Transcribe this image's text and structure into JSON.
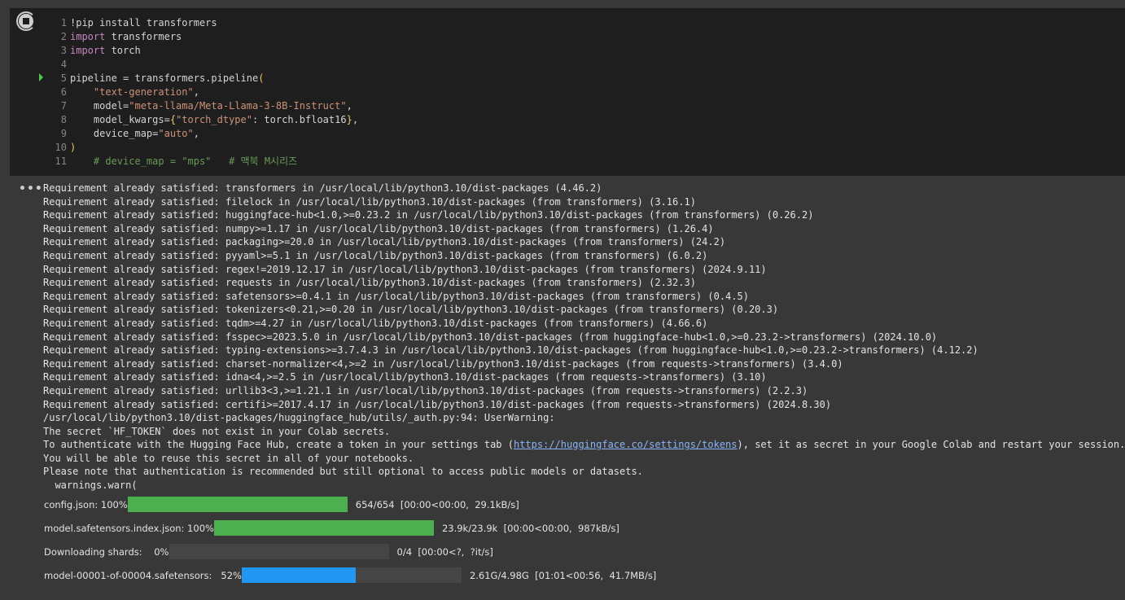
{
  "code_lines": [
    {
      "num": "1",
      "html": "!pip install transformers"
    },
    {
      "num": "2",
      "html": "<span class=\"kw\">import</span> transformers"
    },
    {
      "num": "3",
      "html": "<span class=\"kw\">import</span> torch"
    },
    {
      "num": "4",
      "html": ""
    },
    {
      "num": "5",
      "html": "pipeline = transformers.pipeline<span class=\"br\">(</span>"
    },
    {
      "num": "6",
      "html": "    <span class=\"str\">\"text-generation\"</span>,"
    },
    {
      "num": "7",
      "html": "    model=<span class=\"str\">\"meta-llama/Meta-Llama-3-8B-Instruct\"</span>,"
    },
    {
      "num": "8",
      "html": "    model_kwargs=<span class=\"br\">{</span><span class=\"str\">\"torch_dtype\"</span>: torch.bfloat16<span class=\"br\">}</span>,"
    },
    {
      "num": "9",
      "html": "    device_map=<span class=\"str\">\"auto\"</span>,"
    },
    {
      "num": "10",
      "html": "<span class=\"br\">)</span>"
    },
    {
      "num": "11",
      "html": "    <span class=\"cmt\"># device_map = \"mps\"   # 맥북 M시리즈</span>"
    }
  ],
  "output": {
    "log_lines": [
      "Requirement already satisfied: transformers in /usr/local/lib/python3.10/dist-packages (4.46.2)",
      "Requirement already satisfied: filelock in /usr/local/lib/python3.10/dist-packages (from transformers) (3.16.1)",
      "Requirement already satisfied: huggingface-hub<1.0,>=0.23.2 in /usr/local/lib/python3.10/dist-packages (from transformers) (0.26.2)",
      "Requirement already satisfied: numpy>=1.17 in /usr/local/lib/python3.10/dist-packages (from transformers) (1.26.4)",
      "Requirement already satisfied: packaging>=20.0 in /usr/local/lib/python3.10/dist-packages (from transformers) (24.2)",
      "Requirement already satisfied: pyyaml>=5.1 in /usr/local/lib/python3.10/dist-packages (from transformers) (6.0.2)",
      "Requirement already satisfied: regex!=2019.12.17 in /usr/local/lib/python3.10/dist-packages (from transformers) (2024.9.11)",
      "Requirement already satisfied: requests in /usr/local/lib/python3.10/dist-packages (from transformers) (2.32.3)",
      "Requirement already satisfied: safetensors>=0.4.1 in /usr/local/lib/python3.10/dist-packages (from transformers) (0.4.5)",
      "Requirement already satisfied: tokenizers<0.21,>=0.20 in /usr/local/lib/python3.10/dist-packages (from transformers) (0.20.3)",
      "Requirement already satisfied: tqdm>=4.27 in /usr/local/lib/python3.10/dist-packages (from transformers) (4.66.6)",
      "Requirement already satisfied: fsspec>=2023.5.0 in /usr/local/lib/python3.10/dist-packages (from huggingface-hub<1.0,>=0.23.2->transformers) (2024.10.0)",
      "Requirement already satisfied: typing-extensions>=3.7.4.3 in /usr/local/lib/python3.10/dist-packages (from huggingface-hub<1.0,>=0.23.2->transformers) (4.12.2)",
      "Requirement already satisfied: charset-normalizer<4,>=2 in /usr/local/lib/python3.10/dist-packages (from requests->transformers) (3.4.0)",
      "Requirement already satisfied: idna<4,>=2.5 in /usr/local/lib/python3.10/dist-packages (from requests->transformers) (3.10)",
      "Requirement already satisfied: urllib3<3,>=1.21.1 in /usr/local/lib/python3.10/dist-packages (from requests->transformers) (2.2.3)",
      "Requirement already satisfied: certifi>=2017.4.17 in /usr/local/lib/python3.10/dist-packages (from requests->transformers) (2024.8.30)",
      "/usr/local/lib/python3.10/dist-packages/huggingface_hub/utils/_auth.py:94: UserWarning: ",
      "The secret `HF_TOKEN` does not exist in your Colab secrets."
    ],
    "auth_line_before": "To authenticate with the Hugging Face Hub, create a token in your settings tab (",
    "auth_link": "https://huggingface.co/settings/tokens",
    "auth_line_after": "), set it as secret in your Google Colab and restart your session.",
    "log_tail": [
      "You will be able to reuse this secret in all of your notebooks.",
      "Please note that authentication is recommended but still optional to access public models or datasets.",
      "  warnings.warn("
    ],
    "progress_bars": [
      {
        "label": "config.json: 100%",
        "fraction": 1.0,
        "color": "#4caf50",
        "stats": "654/654  [00:00<00:00,  29.1kB/s]"
      },
      {
        "label": "model.safetensors.index.json: 100%",
        "fraction": 1.0,
        "color": "#4caf50",
        "stats": "23.9k/23.9k  [00:00<00:00,  987kB/s]"
      },
      {
        "label": "Downloading shards:    0%",
        "fraction": 0.0,
        "color": "#4caf50",
        "stats": "0/4  [00:00<?,  ?it/s]"
      },
      {
        "label": "model-00001-of-00004.safetensors:   52%",
        "fraction": 0.52,
        "color": "#2196f3",
        "stats": "2.61G/4.98G  [01:01<00:56,  41.7MB/s]"
      }
    ]
  }
}
